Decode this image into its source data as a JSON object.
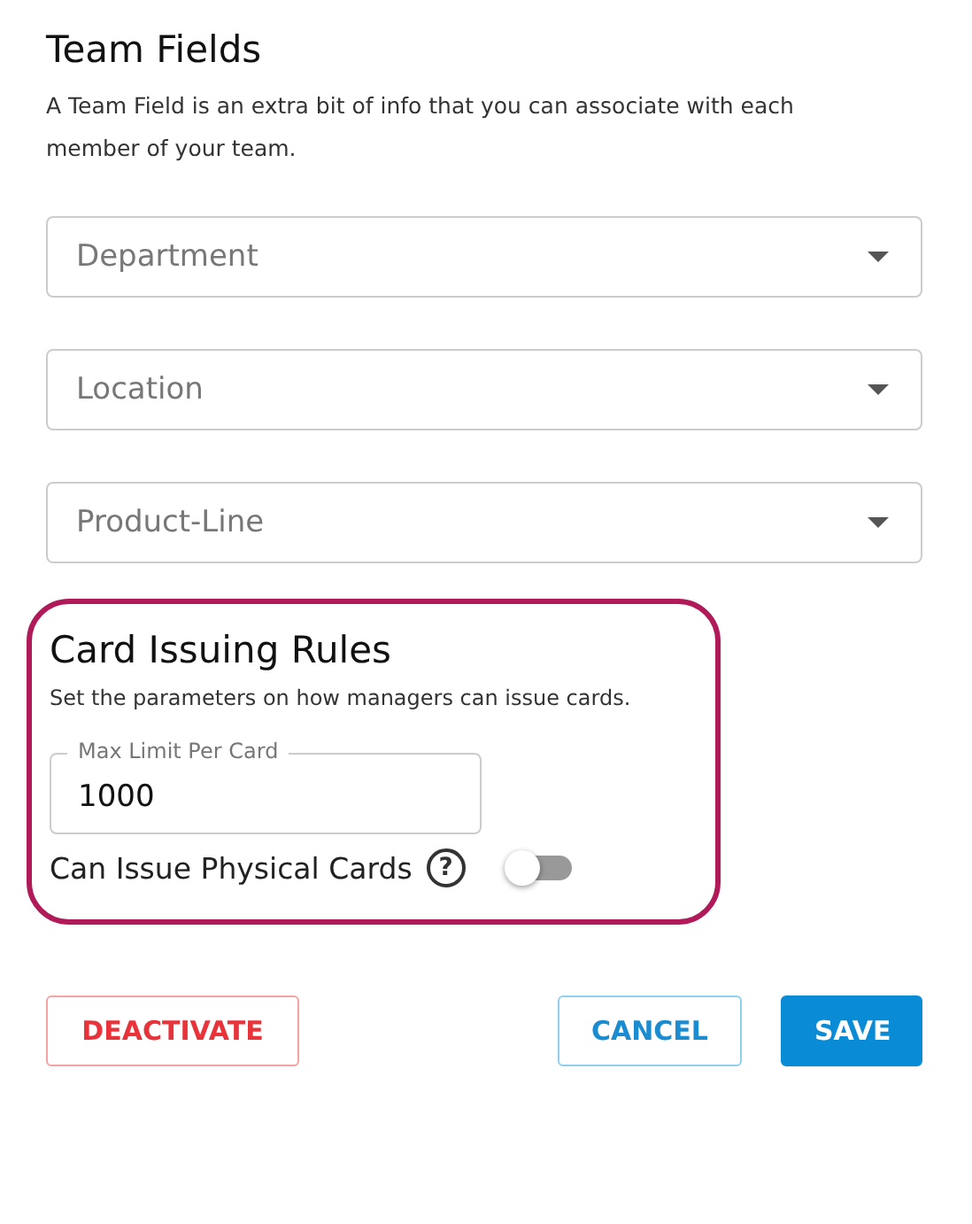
{
  "team_fields": {
    "title": "Team Fields",
    "description": "A Team Field is an extra bit of info that you can associate with each member of your team.",
    "selects": [
      {
        "placeholder": "Department"
      },
      {
        "placeholder": "Location"
      },
      {
        "placeholder": "Product-Line"
      }
    ]
  },
  "card_rules": {
    "highlighted": true,
    "title": "Card Issuing Rules",
    "description": "Set the parameters on how managers can issue cards.",
    "limit_field": {
      "label": "Max Limit Per Card",
      "value": "1000"
    },
    "physical_cards": {
      "label": "Can Issue Physical Cards",
      "help": "?",
      "on": false
    }
  },
  "buttons": [
    {
      "label": "DEACTIVATE",
      "kind": "danger"
    },
    {
      "label": "CANCEL",
      "kind": "outline"
    },
    {
      "label": "SAVE",
      "kind": "primary"
    }
  ]
}
